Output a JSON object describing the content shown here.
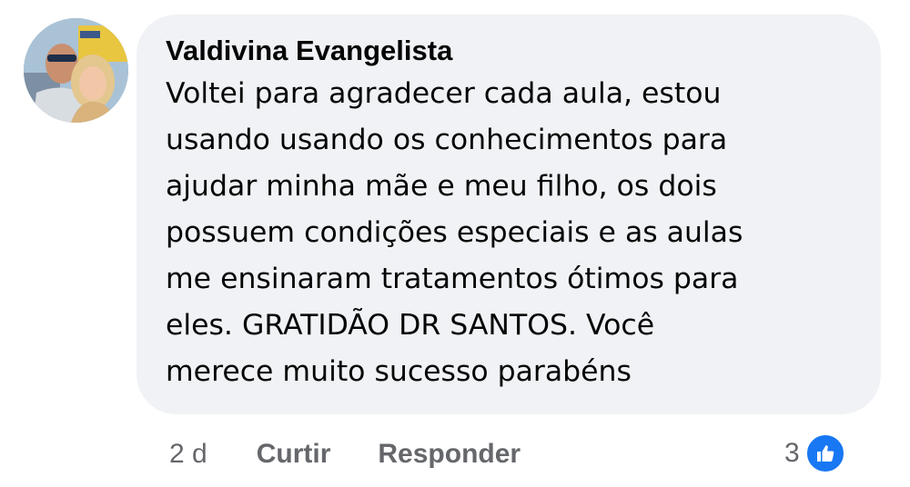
{
  "comment": {
    "author": "Valdivina Evangelista",
    "lines": [
      "Voltei para agradecer cada aula, estou",
      "usando usando os conhecimentos para",
      "ajudar minha mãe e meu filho, os dois",
      "possuem condições especiais e as aulas",
      "me ensinaram tratamentos ótimos para",
      "eles. GRATIDÃO DR SANTOS. Você",
      "merece muito sucesso parabéns"
    ],
    "avatar_icon": "user-photo-avatar"
  },
  "actions": {
    "time": "2 d",
    "like_label": "Curtir",
    "reply_label": "Responder"
  },
  "reactions": {
    "count": "3",
    "icon": "like-thumb-icon",
    "color": "#1877f2"
  },
  "colors": {
    "bubble": "#f0f2f5",
    "text": "#050505",
    "muted": "#65676b"
  }
}
